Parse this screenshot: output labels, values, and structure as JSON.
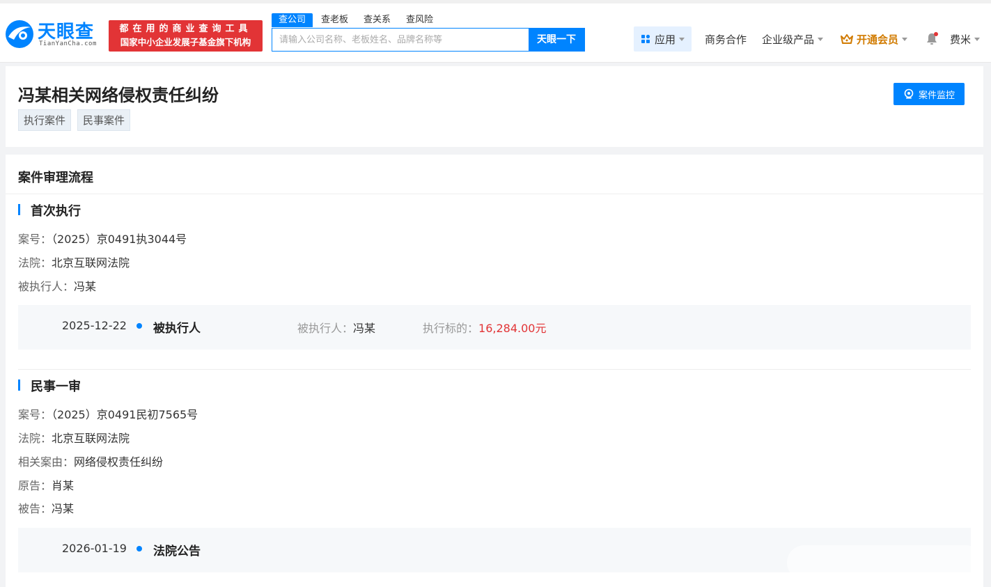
{
  "header": {
    "logo_text": "天眼查",
    "logo_sub": "TianYanCha.com",
    "slogan_line1": "都在用的商业查询工具",
    "slogan_line2": "国家中小企业发展子基金旗下机构",
    "search_tabs": [
      {
        "label": "查公司"
      },
      {
        "label": "查老板"
      },
      {
        "label": "查关系"
      },
      {
        "label": "查风险"
      }
    ],
    "search_placeholder": "请输入公司名称、老板姓名、品牌名称等",
    "search_button": "天眼一下",
    "nav": {
      "apps": "应用",
      "business": "商务合作",
      "enterprise": "企业级产品",
      "vip": "开通会员",
      "user": "费米"
    }
  },
  "case": {
    "title": "冯某相关网络侵权责任纠纷",
    "tags": [
      "执行案件",
      "民事案件"
    ],
    "monitor_button": "案件监控"
  },
  "process": {
    "title": "案件审理流程",
    "sections": [
      {
        "title": "首次执行",
        "fields": [
          {
            "label": "案号：",
            "value": "（2025）京0491执3044号"
          },
          {
            "label": "法院：",
            "value": "北京互联网法院"
          },
          {
            "label": "被执行人：",
            "value": "冯某"
          }
        ],
        "event": {
          "date": "2025-12-22",
          "type": "被执行人",
          "party_label": "被执行人：",
          "party_value": "冯某",
          "amount_label": "执行标的：",
          "amount_value": "16,284.00元"
        }
      },
      {
        "title": "民事一审",
        "fields": [
          {
            "label": "案号：",
            "value": "（2025）京0491民初7565号"
          },
          {
            "label": "法院：",
            "value": "北京互联网法院"
          },
          {
            "label": "相关案由：",
            "value": "网络侵权责任纠纷"
          },
          {
            "label": "原告：",
            "value": "肖某"
          },
          {
            "label": "被告：",
            "value": "冯某"
          }
        ],
        "event": {
          "date": "2026-01-19",
          "type": "法院公告"
        }
      }
    ]
  },
  "colors": {
    "brand_blue": "#0084ff",
    "slogan_red": "#e23436",
    "amount_red": "#e23436",
    "vip_gold": "#d17b00"
  }
}
